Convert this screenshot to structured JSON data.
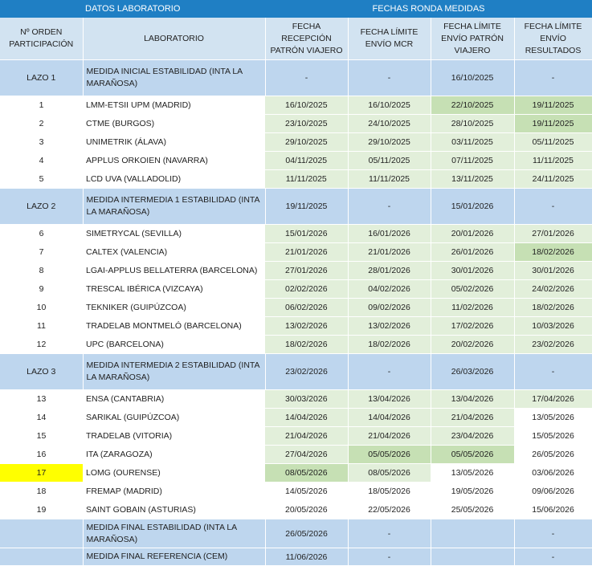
{
  "header": {
    "datos_label": "DATOS LABORATORIO",
    "fechas_label": "FECHAS RONDA MEDIDAS"
  },
  "columns": {
    "orden": "Nº ORDEN PARTICIPACIÓN",
    "laboratorio": "LABORATORIO",
    "recepcion": "FECHA RECEPCIÓN PATRÓN VIAJERO",
    "mcr": "FECHA LÍMITE ENVÍO MCR",
    "envio_patron": "FECHA LÍMITE ENVÍO PATRÓN VIAJERO",
    "resultados": "FECHA LÍMITE ENVÍO RESULTADOS"
  },
  "lazos": [
    {
      "label": "LAZO 1",
      "medida": "MEDIDA INICIAL ESTABILIDAD (INTA LA MARAÑOSA)",
      "recepcion": "-",
      "mcr": "-",
      "envio": "16/10/2025",
      "resultados": "-"
    },
    {
      "label": "LAZO 2",
      "medida": "MEDIDA INTERMEDIA 1 ESTABILIDAD (INTA LA MARAÑOSA)",
      "recepcion": "19/11/2025",
      "mcr": "-",
      "envio": "15/01/2026",
      "resultados": "-"
    },
    {
      "label": "LAZO 3",
      "medida": "MEDIDA INTERMEDIA 2 ESTABILIDAD (INTA LA MARAÑOSA)",
      "recepcion": "23/02/2026",
      "mcr": "-",
      "envio": "26/03/2026",
      "resultados": "-"
    }
  ],
  "rows": [
    {
      "n": "1",
      "lab": "LMM-ETSII UPM (MADRID)",
      "recepcion": "16/10/2025",
      "mcr": "16/10/2025",
      "envio": "22/10/2025",
      "resultados": "19/11/2025"
    },
    {
      "n": "2",
      "lab": "CTME (BURGOS)",
      "recepcion": "23/10/2025",
      "mcr": "24/10/2025",
      "envio": "28/10/2025",
      "resultados": "19/11/2025"
    },
    {
      "n": "3",
      "lab": "UNIMETRIK (ÁLAVA)",
      "recepcion": "29/10/2025",
      "mcr": "29/10/2025",
      "envio": "03/11/2025",
      "resultados": "05/11/2025"
    },
    {
      "n": "4",
      "lab": "APPLUS ORKOIEN (NAVARRA)",
      "recepcion": "04/11/2025",
      "mcr": "05/11/2025",
      "envio": "07/11/2025",
      "resultados": "11/11/2025"
    },
    {
      "n": "5",
      "lab": "LCD UVA (VALLADOLID)",
      "recepcion": "11/11/2025",
      "mcr": "11/11/2025",
      "envio": "13/11/2025",
      "resultados": "24/11/2025"
    },
    {
      "n": "6",
      "lab": "SIMETRYCAL (SEVILLA)",
      "recepcion": "15/01/2026",
      "mcr": "16/01/2026",
      "envio": "20/01/2026",
      "resultados": "27/01/2026"
    },
    {
      "n": "7",
      "lab": "CALTEX (VALENCIA)",
      "recepcion": "21/01/2026",
      "mcr": "21/01/2026",
      "envio": "26/01/2026",
      "resultados": "18/02/2026"
    },
    {
      "n": "8",
      "lab": "LGAI-APPLUS BELLATERRA (BARCELONA)",
      "recepcion": "27/01/2026",
      "mcr": "28/01/2026",
      "envio": "30/01/2026",
      "resultados": "30/01/2026"
    },
    {
      "n": "9",
      "lab": "TRESCAL IBÉRICA (VIZCAYA)",
      "recepcion": "02/02/2026",
      "mcr": "04/02/2026",
      "envio": "05/02/2026",
      "resultados": "24/02/2026"
    },
    {
      "n": "10",
      "lab": "TEKNIKER (GUIPÚZCOA)",
      "recepcion": "06/02/2026",
      "mcr": "09/02/2026",
      "envio": "11/02/2026",
      "resultados": "18/02/2026"
    },
    {
      "n": "11",
      "lab": "TRADELAB MONTMELÓ (BARCELONA)",
      "recepcion": "13/02/2026",
      "mcr": "13/02/2026",
      "envio": "17/02/2026",
      "resultados": "10/03/2026"
    },
    {
      "n": "12",
      "lab": "UPC (BARCELONA)",
      "recepcion": "18/02/2026",
      "mcr": "18/02/2026",
      "envio": "20/02/2026",
      "resultados": "23/02/2026"
    },
    {
      "n": "13",
      "lab": "ENSA (CANTABRIA)",
      "recepcion": "30/03/2026",
      "mcr": "13/04/2026",
      "envio": "13/04/2026",
      "resultados": "17/04/2026"
    },
    {
      "n": "14",
      "lab": "SARIKAL (GUIPÚZCOA)",
      "recepcion": "14/04/2026",
      "mcr": "14/04/2026",
      "envio": "21/04/2026",
      "resultados": "13/05/2026"
    },
    {
      "n": "15",
      "lab": "TRADELAB (VITORIA)",
      "recepcion": "21/04/2026",
      "mcr": "21/04/2026",
      "envio": "23/04/2026",
      "resultados": "15/05/2026"
    },
    {
      "n": "16",
      "lab": "ITA (ZARAGOZA)",
      "recepcion": "27/04/2026",
      "mcr": "05/05/2026",
      "envio": "05/05/2026",
      "resultados": "26/05/2026"
    },
    {
      "n": "17",
      "lab": "LOMG (OURENSE)",
      "recepcion": "08/05/2026",
      "mcr": "08/05/2026",
      "envio": "13/05/2026",
      "resultados": "03/06/2026"
    },
    {
      "n": "18",
      "lab": "FREMAP (MADRID)",
      "recepcion": "14/05/2026",
      "mcr": "18/05/2026",
      "envio": "19/05/2026",
      "resultados": "09/06/2026"
    },
    {
      "n": "19",
      "lab": "SAINT GOBAIN (ASTURIAS)",
      "recepcion": "20/05/2026",
      "mcr": "22/05/2026",
      "envio": "25/05/2026",
      "resultados": "15/06/2026"
    }
  ],
  "finals": [
    {
      "medida": "MEDIDA FINAL ESTABILIDAD (INTA LA MARAÑOSA)",
      "recepcion": "26/05/2026",
      "mcr": "-",
      "envio": "",
      "resultados": "-"
    },
    {
      "medida": "MEDIDA FINAL REFERENCIA (CEM)",
      "recepcion": "11/06/2026",
      "mcr": "-",
      "envio": "",
      "resultados": "-"
    }
  ],
  "colors": {
    "header_blue": "#1f7fc4",
    "col_header": "#d2e3f1",
    "lazo_blue": "#bed6ee",
    "light_green": "#e2efda",
    "dark_green": "#c6e0b4",
    "highlight_yellow": "#ffff00"
  }
}
